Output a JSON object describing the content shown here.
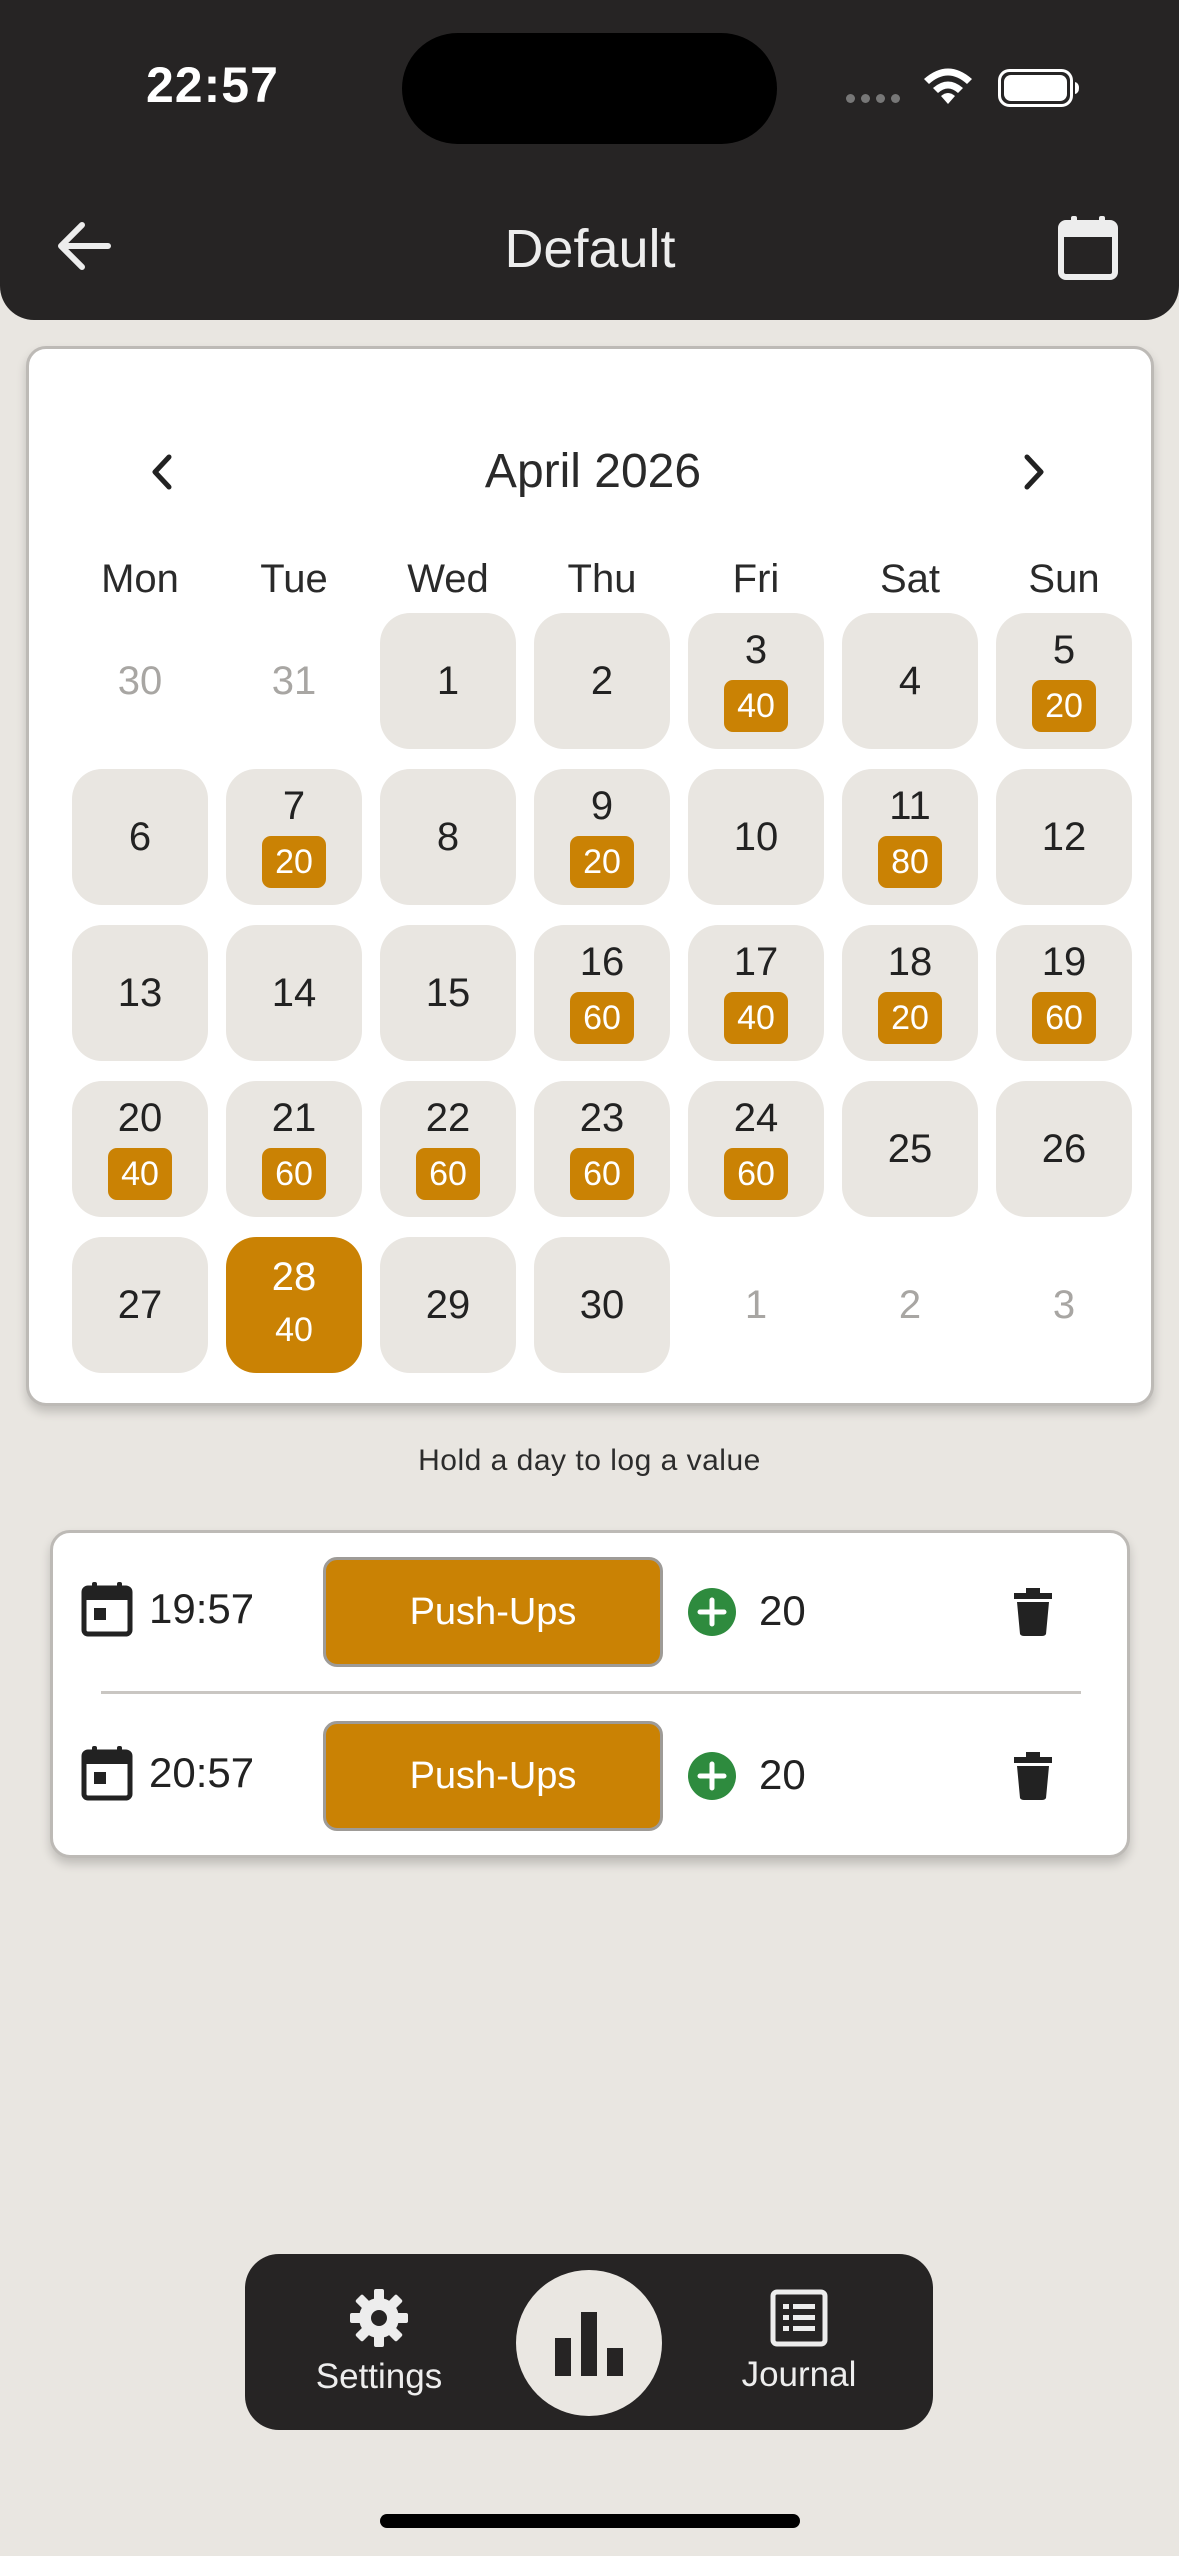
{
  "status_bar": {
    "time": "22:57"
  },
  "header": {
    "title": "Default"
  },
  "calendar": {
    "month_label": "April 2026",
    "weekdays": [
      "Mon",
      "Tue",
      "Wed",
      "Thu",
      "Fri",
      "Sat",
      "Sun"
    ],
    "days": [
      {
        "day": "30",
        "outside": true,
        "value": null
      },
      {
        "day": "31",
        "outside": true,
        "value": null
      },
      {
        "day": "1",
        "outside": false,
        "value": null
      },
      {
        "day": "2",
        "outside": false,
        "value": null
      },
      {
        "day": "3",
        "outside": false,
        "value": "40"
      },
      {
        "day": "4",
        "outside": false,
        "value": null
      },
      {
        "day": "5",
        "outside": false,
        "value": "20"
      },
      {
        "day": "6",
        "outside": false,
        "value": null
      },
      {
        "day": "7",
        "outside": false,
        "value": "20"
      },
      {
        "day": "8",
        "outside": false,
        "value": null
      },
      {
        "day": "9",
        "outside": false,
        "value": "20"
      },
      {
        "day": "10",
        "outside": false,
        "value": null
      },
      {
        "day": "11",
        "outside": false,
        "value": "80"
      },
      {
        "day": "12",
        "outside": false,
        "value": null
      },
      {
        "day": "13",
        "outside": false,
        "value": null
      },
      {
        "day": "14",
        "outside": false,
        "value": null
      },
      {
        "day": "15",
        "outside": false,
        "value": null
      },
      {
        "day": "16",
        "outside": false,
        "value": "60"
      },
      {
        "day": "17",
        "outside": false,
        "value": "40"
      },
      {
        "day": "18",
        "outside": false,
        "value": "20"
      },
      {
        "day": "19",
        "outside": false,
        "value": "60"
      },
      {
        "day": "20",
        "outside": false,
        "value": "40"
      },
      {
        "day": "21",
        "outside": false,
        "value": "60"
      },
      {
        "day": "22",
        "outside": false,
        "value": "60"
      },
      {
        "day": "23",
        "outside": false,
        "value": "60"
      },
      {
        "day": "24",
        "outside": false,
        "value": "60"
      },
      {
        "day": "25",
        "outside": false,
        "value": null
      },
      {
        "day": "26",
        "outside": false,
        "value": null
      },
      {
        "day": "27",
        "outside": false,
        "value": null
      },
      {
        "day": "28",
        "outside": false,
        "value": "40",
        "selected": true
      },
      {
        "day": "29",
        "outside": false,
        "value": null
      },
      {
        "day": "30",
        "outside": false,
        "value": null
      },
      {
        "day": "1",
        "outside": true,
        "value": null
      },
      {
        "day": "2",
        "outside": true,
        "value": null
      },
      {
        "day": "3",
        "outside": true,
        "value": null
      }
    ]
  },
  "hint": "Hold a day to log a value",
  "entries": [
    {
      "time": "19:57",
      "exercise": "Push-Ups",
      "amount": "20"
    },
    {
      "time": "20:57",
      "exercise": "Push-Ups",
      "amount": "20"
    }
  ],
  "nav": {
    "settings_label": "Settings",
    "journal_label": "Journal"
  },
  "colors": {
    "accent": "#CA8204",
    "dark": "#262424",
    "background": "#E9E6E1",
    "day_cell": "#E9E6E1",
    "plus_green": "#2E8B3E"
  },
  "icons": {
    "back": "arrow-left-icon",
    "calendar": "calendar-icon",
    "prev_month": "chevron-left-icon",
    "next_month": "chevron-right-icon",
    "entry_date": "calendar-event-icon",
    "entry_add": "plus-circle-icon",
    "entry_delete": "trash-icon",
    "settings": "gear-icon",
    "stats": "bar-chart-icon",
    "journal": "list-document-icon"
  }
}
